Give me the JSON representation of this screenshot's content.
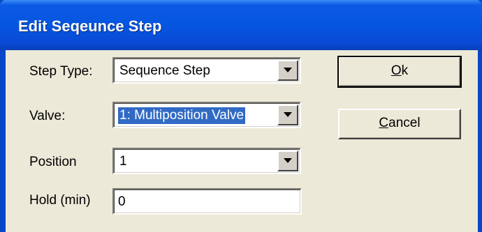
{
  "window": {
    "title": "Edit Seqeunce Step"
  },
  "form": {
    "step_type": {
      "label": "Step Type:",
      "value": "Sequence Step"
    },
    "valve": {
      "label": "Valve:",
      "value": "1: Multiposition Valve"
    },
    "position": {
      "label": "Position",
      "value": "1"
    },
    "hold": {
      "label": "Hold (min)",
      "value": "0"
    }
  },
  "buttons": {
    "ok": {
      "mnemonic": "O",
      "rest": "k"
    },
    "cancel": {
      "mnemonic": "C",
      "rest": "ancel"
    }
  },
  "icons": {
    "dropdown": "chevron-down-icon"
  },
  "colors": {
    "titlebar": "#0655e0",
    "dialog_background": "#ece9d8",
    "selection": "#316ac5"
  }
}
